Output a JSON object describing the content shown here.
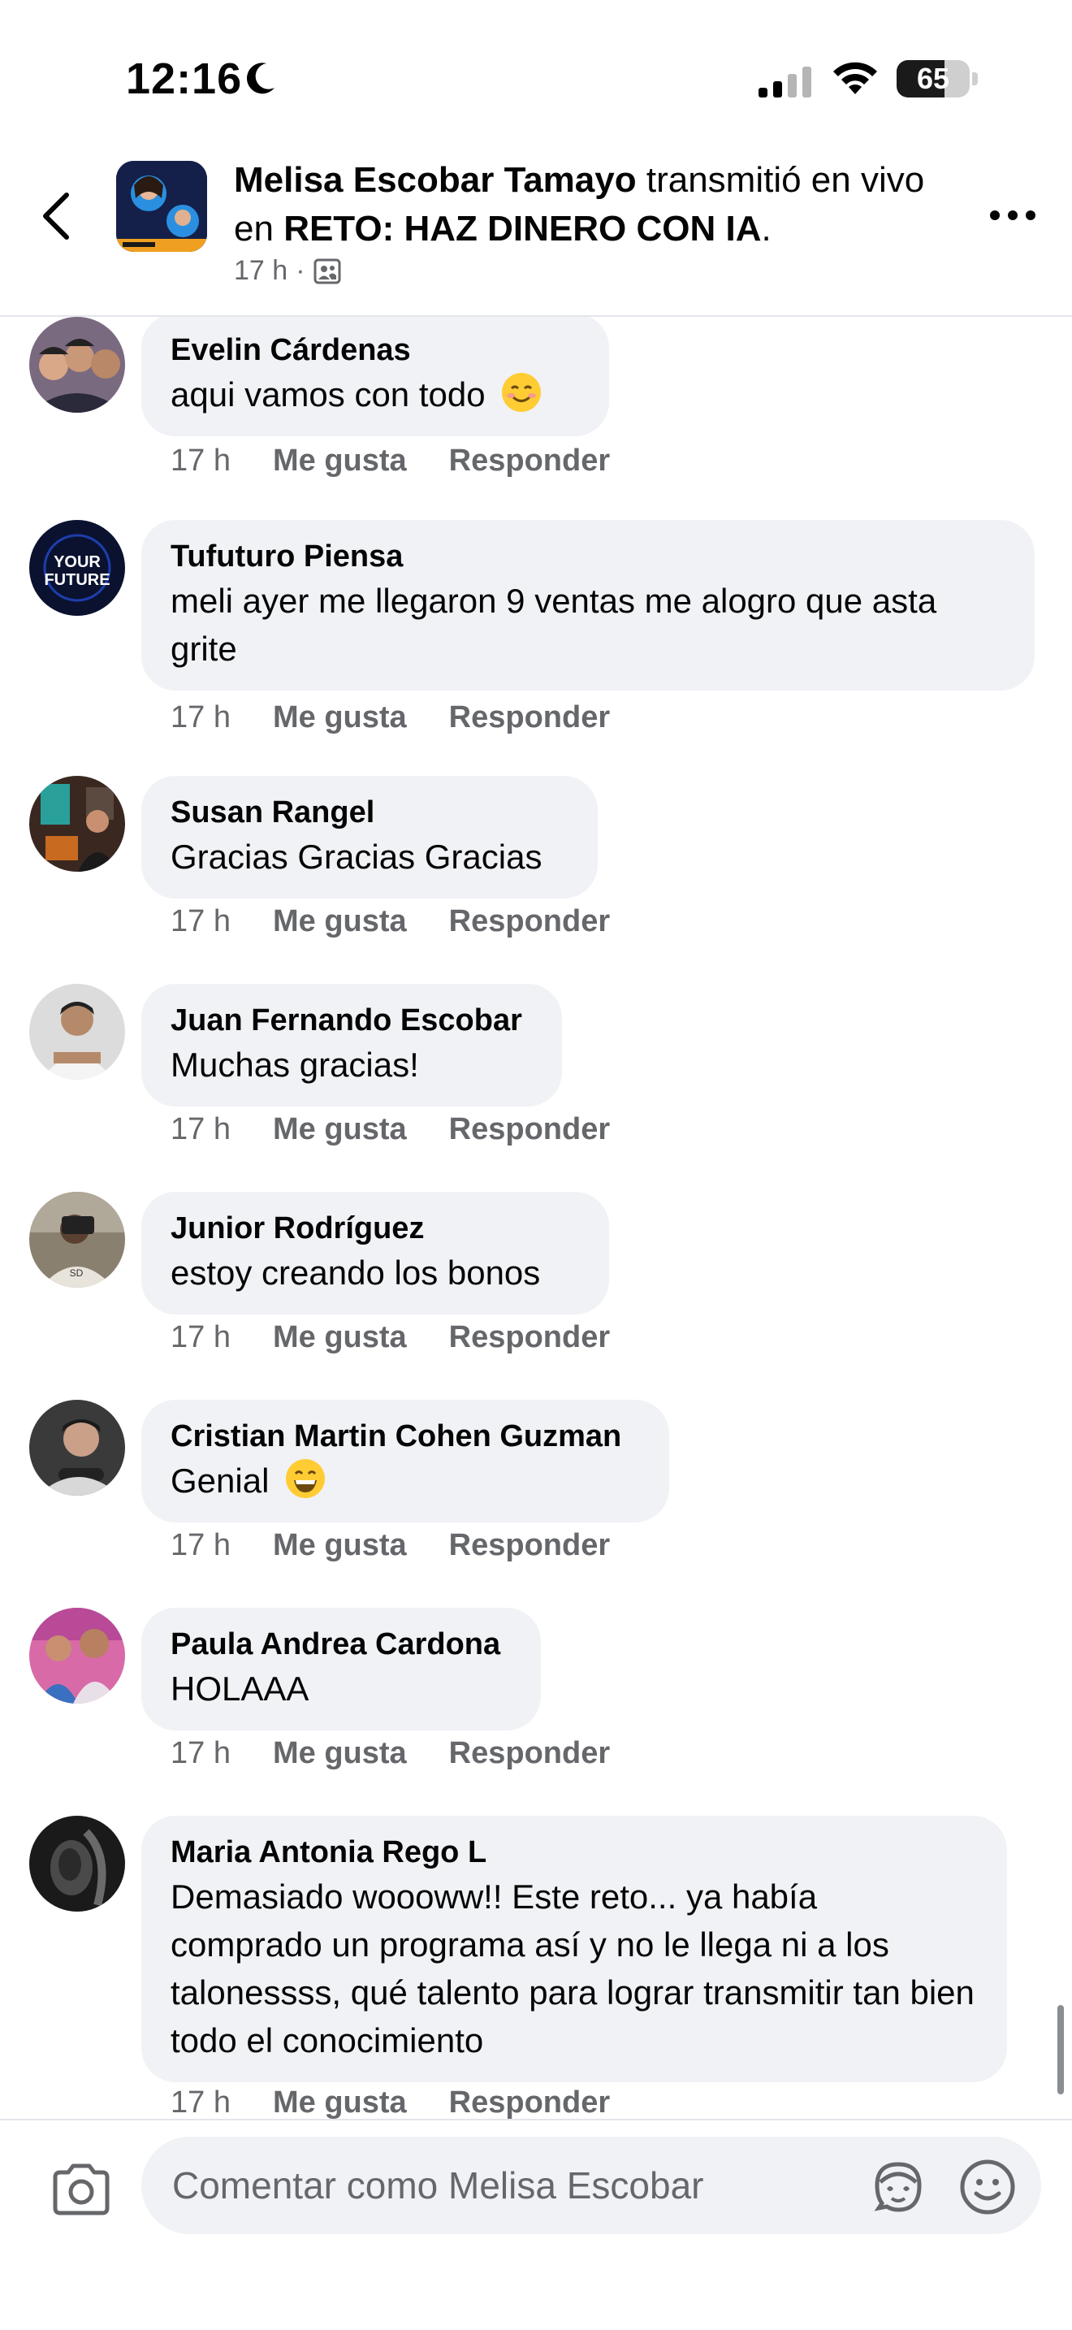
{
  "status_bar": {
    "time": "12:16",
    "battery_percent": "65",
    "battery_level": 0.65
  },
  "header": {
    "author": "Melisa Escobar Tamayo",
    "action_text": "transmitió en vivo en",
    "group": "RETO: HAZ DINERO CON IA",
    "period": ".",
    "time": "17 h",
    "privacy_icon": "group-members-icon"
  },
  "comments": [
    {
      "name": "Evelin Cárdenas",
      "text": "aqui vamos con todo",
      "emoji": "smiling-face-emoji",
      "time": "17 h",
      "like": "Me gusta",
      "reply": "Responder"
    },
    {
      "name": "Tufuturo Piensa",
      "text": "meli ayer me llegaron 9 ventas me alogro que asta grite",
      "time": "17 h",
      "like": "Me gusta",
      "reply": "Responder",
      "avatar_text_1": "YOUR",
      "avatar_text_2": "FUTURE"
    },
    {
      "name": "Susan Rangel",
      "text": "Gracias Gracias Gracias",
      "time": "17 h",
      "like": "Me gusta",
      "reply": "Responder"
    },
    {
      "name": "Juan Fernando Escobar",
      "text": "Muchas gracias!",
      "time": "17 h",
      "like": "Me gusta",
      "reply": "Responder"
    },
    {
      "name": "Junior Rodríguez",
      "text": "estoy creando los bonos",
      "time": "17 h",
      "like": "Me gusta",
      "reply": "Responder"
    },
    {
      "name": "Cristian Martin Cohen Guzman",
      "text": "Genial",
      "emoji": "grinning-face-emoji",
      "time": "17 h",
      "like": "Me gusta",
      "reply": "Responder"
    },
    {
      "name": "Paula Andrea Cardona",
      "text": "HOLAAA",
      "time": "17 h",
      "like": "Me gusta",
      "reply": "Responder"
    },
    {
      "name": "Maria Antonia Rego L",
      "text": "Demasiado woooww!! Este reto... ya había comprado un programa así y no le llega ni a los talonessss, qué talento para lograr transmitir tan bien todo el conocimiento",
      "time": "17 h",
      "like": "Me gusta",
      "reply": "Responder"
    }
  ],
  "composer": {
    "placeholder": "Comentar como Melisa Escobar"
  },
  "colors": {
    "bubble": "#f0f2f5",
    "secondary_text": "#65676b",
    "primary_text": "#050505"
  }
}
